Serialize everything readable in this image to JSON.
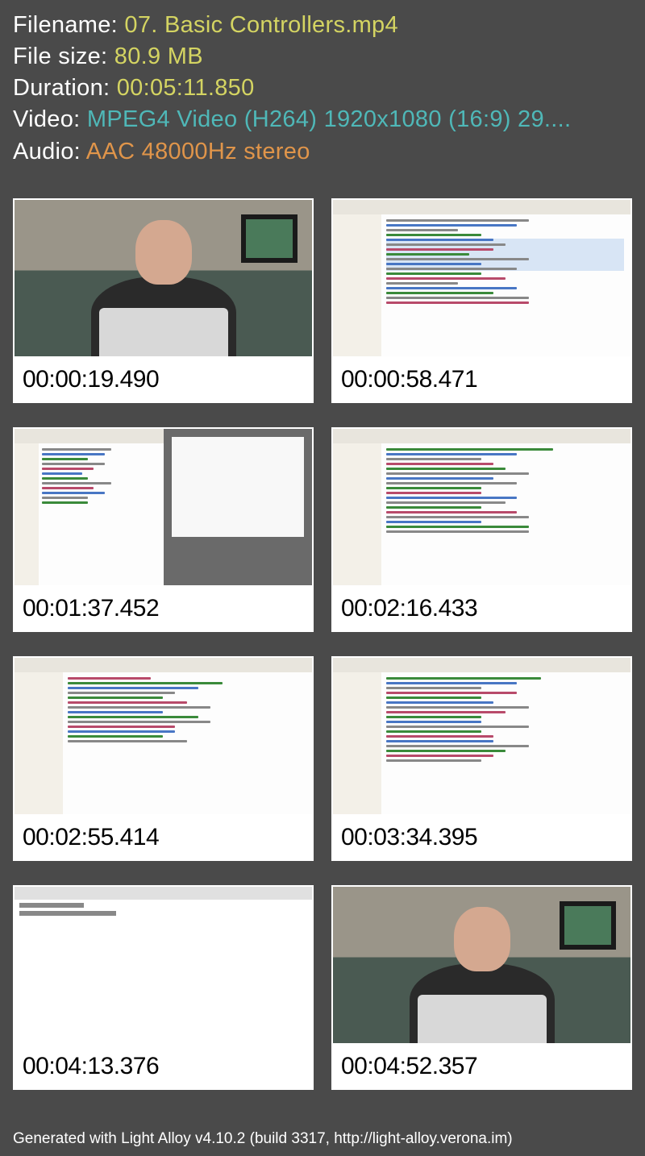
{
  "header": {
    "filename_label": "Filename: ",
    "filename_value": "07. Basic Controllers.mp4",
    "filesize_label": "File size: ",
    "filesize_value": "80.9 MB",
    "duration_label": "Duration: ",
    "duration_value": "00:05:11.850",
    "video_label": "Video: ",
    "video_value": "MPEG4 Video (H264) 1920x1080 (16:9) 29....",
    "audio_label": "Audio: ",
    "audio_value": "AAC 48000Hz stereo"
  },
  "thumbnails": [
    {
      "timestamp": "00:00:19.490",
      "type": "person"
    },
    {
      "timestamp": "00:00:58.471",
      "type": "code-highlight"
    },
    {
      "timestamp": "00:01:37.452",
      "type": "split"
    },
    {
      "timestamp": "00:02:16.433",
      "type": "code"
    },
    {
      "timestamp": "00:02:55.414",
      "type": "code"
    },
    {
      "timestamp": "00:03:34.395",
      "type": "code"
    },
    {
      "timestamp": "00:04:13.376",
      "type": "browser"
    },
    {
      "timestamp": "00:04:52.357",
      "type": "person"
    }
  ],
  "footer": {
    "text": "Generated with Light Alloy v4.10.2 (build 3317, http://light-alloy.verona.im)"
  }
}
